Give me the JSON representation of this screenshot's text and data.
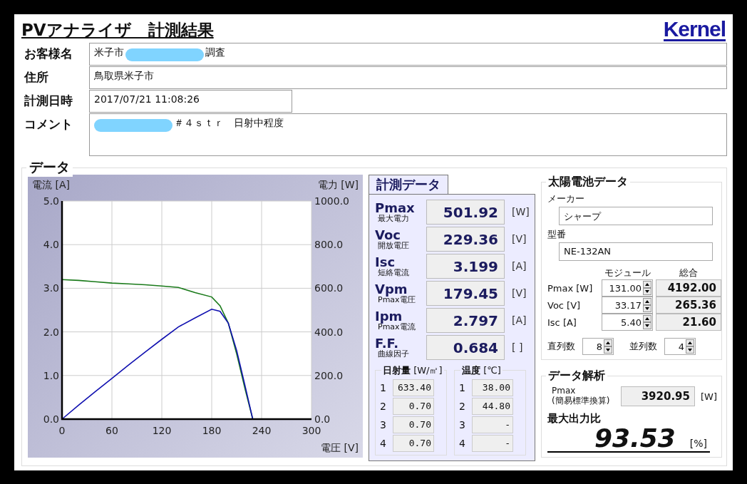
{
  "title": "PVアナライザ　計測結果",
  "logo": "Kernel",
  "info": [
    {
      "label": "お客様名",
      "kind": "wide",
      "segments": [
        {
          "kind": "text",
          "text": "米子市"
        },
        {
          "kind": "redaction"
        },
        {
          "kind": "text",
          "text": "調査"
        }
      ]
    },
    {
      "label": "住所",
      "kind": "wide",
      "segments": [
        {
          "kind": "text",
          "text": "鳥取県米子市"
        }
      ]
    },
    {
      "label": "計測日時",
      "kind": "short",
      "segments": [
        {
          "kind": "text",
          "text": "2017/07/21 11:08:26"
        }
      ]
    },
    {
      "label": "コメント",
      "kind": "multiline",
      "segments": [
        {
          "kind": "redaction"
        },
        {
          "kind": "text",
          "text": "＃４ｓｔｒ　日射中程度"
        }
      ]
    }
  ],
  "data_section": {
    "legend": "データ",
    "graph": {
      "chart_data": {
        "type": "line",
        "xlabel": "電圧 [V]",
        "ylabel": "電流 [A]",
        "y2label": "電力 [W]",
        "x": [
          0,
          20,
          40,
          60,
          80,
          100,
          120,
          140,
          160,
          180,
          190,
          200,
          210,
          220,
          229.36
        ],
        "series": [
          {
            "color": "#1a7a1a",
            "axis": "y",
            "values": [
              3.2,
              3.18,
              3.15,
              3.12,
              3.1,
              3.08,
              3.05,
              3.02,
              2.9,
              2.8,
              2.6,
              2.2,
              1.5,
              0.7,
              0
            ]
          },
          {
            "color": "#1010b0",
            "axis": "y2",
            "values": [
              0,
              64,
              126,
              187,
              248,
              308,
              366,
              423,
              464,
              504,
              494,
              440,
              315,
              154,
              0
            ]
          }
        ],
        "grid": true,
        "xlim": [
          0,
          300
        ],
        "ylim": [
          0,
          5
        ],
        "y2lim": [
          0,
          1000
        ],
        "xticks": [
          0,
          60,
          120,
          180,
          240,
          300
        ],
        "yticks": [
          {
            "value": 0,
            "label": "0.0"
          },
          {
            "value": 1,
            "label": "1.0"
          },
          {
            "value": 2,
            "label": "2.0"
          },
          {
            "value": 3,
            "label": "3.0"
          },
          {
            "value": 4,
            "label": "4.0"
          },
          {
            "value": 5,
            "label": "5.0"
          }
        ],
        "y2ticks": [
          {
            "value": 0,
            "label": "0.0"
          },
          {
            "value": 200,
            "label": "200.0"
          },
          {
            "value": 400,
            "label": "400.0"
          },
          {
            "value": 600,
            "label": "600.0"
          },
          {
            "value": 800,
            "label": "800.0"
          },
          {
            "value": 1000,
            "label": "1000.0"
          }
        ]
      }
    },
    "measurement": {
      "tab": "計測データ",
      "metrics": [
        {
          "name": "Pmax",
          "sub": "最大電力",
          "value": "501.92",
          "unit": "[W]"
        },
        {
          "name": "Voc",
          "sub": "開放電圧",
          "value": "229.36",
          "unit": "[V]"
        },
        {
          "name": "Isc",
          "sub": "短絡電流",
          "value": "3.199",
          "unit": "[A]"
        },
        {
          "name": "Vpm",
          "sub": "Pmax電圧",
          "value": "179.45",
          "unit": "[V]"
        },
        {
          "name": "Ipm",
          "sub": "Pmax電流",
          "value": "2.797",
          "unit": "[A]"
        },
        {
          "name": "F.F.",
          "sub": "曲線因子",
          "value": "0.684",
          "unit": "[ ]"
        }
      ],
      "sensors": [
        {
          "title": "**日射量** [W/㎡]",
          "rows": [
            {
              "index": "1",
              "value": "633.40"
            },
            {
              "index": "2",
              "value": "0.70"
            },
            {
              "index": "3",
              "value": "0.70"
            },
            {
              "index": "4",
              "value": "0.70"
            }
          ]
        },
        {
          "title": "**温度** [℃]",
          "rows": [
            {
              "index": "1",
              "value": "38.00"
            },
            {
              "index": "2",
              "value": "44.80"
            },
            {
              "index": "3",
              "value": "-"
            },
            {
              "index": "4",
              "value": "-"
            }
          ]
        }
      ]
    },
    "solar_cell": {
      "legend": "太陽電池データ",
      "maker_label": "メーカー",
      "maker": "シャープ",
      "model_label": "型番",
      "model": "NE-132AN",
      "columns": [
        "モジュール",
        "総合"
      ],
      "rows": [
        {
          "label": "Pmax [W]",
          "module": "131.00",
          "total": "4192.00"
        },
        {
          "label": "Voc [V]",
          "module": "33.17",
          "total": "265.36"
        },
        {
          "label": "Isc [A]",
          "module": "5.40",
          "total": "21.60"
        }
      ],
      "counts": [
        {
          "label": "直列数",
          "value": "8"
        },
        {
          "label": "並列数",
          "value": "4"
        }
      ]
    },
    "analysis": {
      "legend": "データ解析",
      "pmax_label": [
        "Pmax",
        "(簡易標準換算)"
      ],
      "pmax_value": "3920.95",
      "pmax_unit": "[W]",
      "ratio_label": "最大出力比",
      "ratio_value": "93.53",
      "ratio_unit": "[%]"
    }
  }
}
